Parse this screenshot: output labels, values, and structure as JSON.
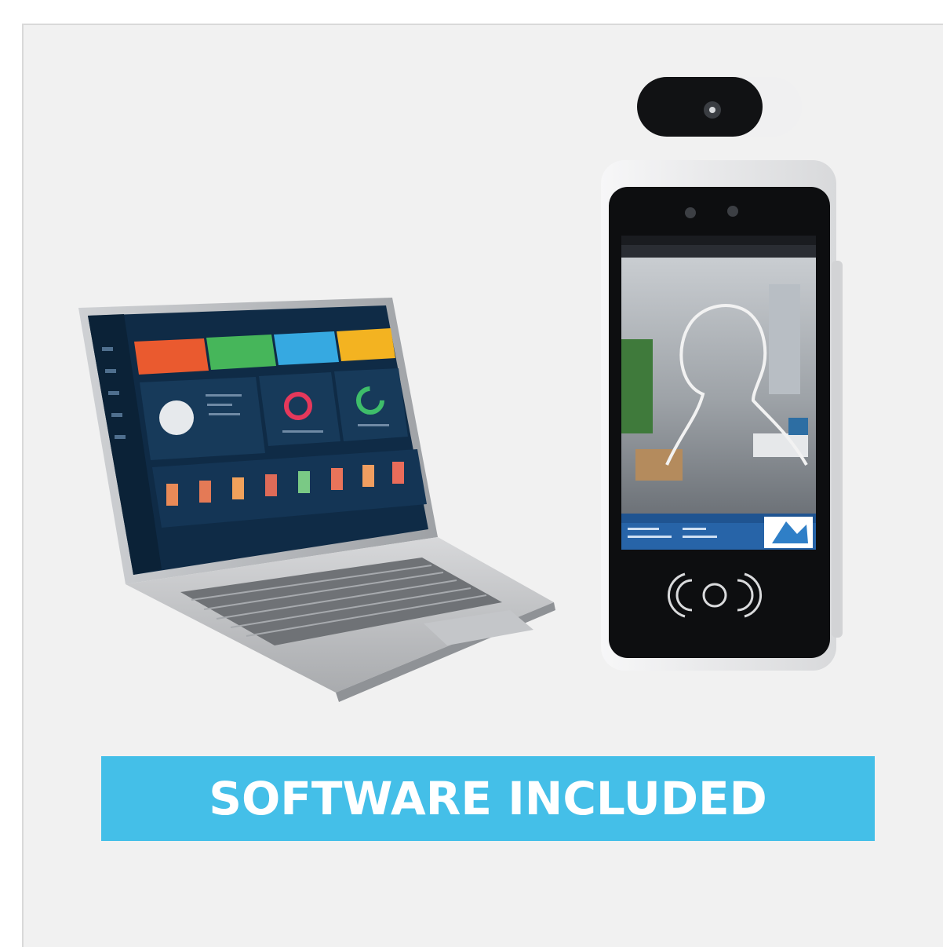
{
  "banner": {
    "label": "SOFTWARE INCLUDED",
    "background": "#44bfe8",
    "text_color": "#ffffff"
  },
  "illustration": {
    "items": [
      "laptop-with-dashboard",
      "face-recognition-terminal"
    ],
    "dashboard_tiles": [
      "#ea5a2f",
      "#46b65a",
      "#36a9e1",
      "#f3b321"
    ],
    "dashboard_background": "#0f2b46"
  }
}
